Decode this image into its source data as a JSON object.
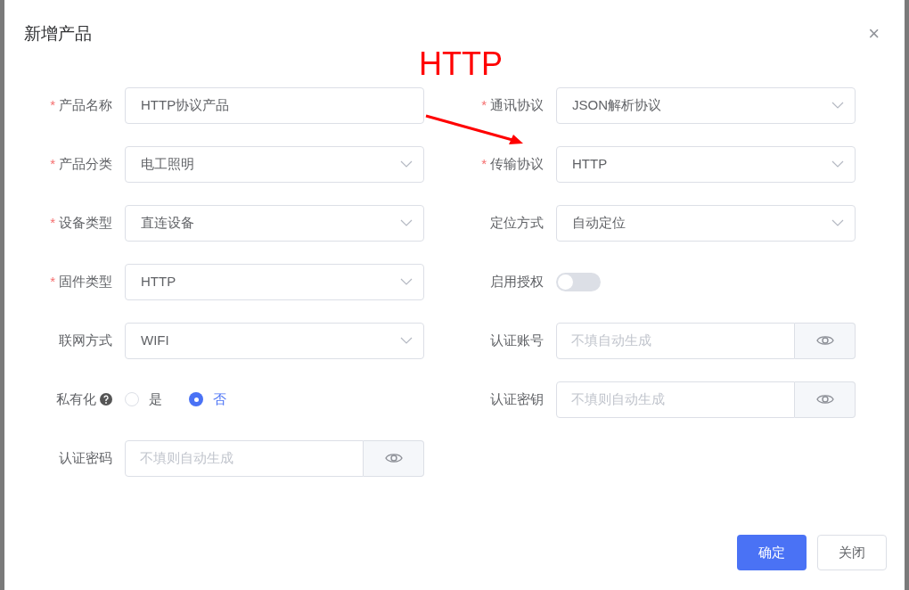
{
  "dialog": {
    "title": "新增产品",
    "close": "×"
  },
  "annotation": {
    "text": "HTTP"
  },
  "left_fields": [
    {
      "kind": "input",
      "label": "产品名称",
      "required_mark": "*",
      "value": "HTTP协议产品"
    },
    {
      "kind": "select",
      "label": "产品分类",
      "required_mark": "*",
      "value": "电工照明"
    },
    {
      "kind": "select",
      "label": "设备类型",
      "required_mark": "*",
      "value": "直连设备"
    },
    {
      "kind": "select",
      "label": "固件类型",
      "required_mark": "*",
      "value": "HTTP"
    },
    {
      "kind": "select",
      "label": "联网方式",
      "value": "WIFI"
    },
    {
      "kind": "radio",
      "label": "私有化",
      "help": true,
      "options": [
        {
          "label": "是",
          "selected": false
        },
        {
          "label": "否",
          "selected": true
        }
      ]
    },
    {
      "kind": "secret",
      "label": "认证密码",
      "placeholder": "不填则自动生成"
    }
  ],
  "right_fields": [
    {
      "kind": "select",
      "label": "通讯协议",
      "required_mark": "*",
      "value": "JSON解析协议"
    },
    {
      "kind": "select",
      "label": "传输协议",
      "required_mark": "*",
      "value": "HTTP"
    },
    {
      "kind": "select",
      "label": "定位方式",
      "value": "自动定位"
    },
    {
      "kind": "switch",
      "label": "启用授权",
      "on": false
    },
    {
      "kind": "secret",
      "label": "认证账号",
      "placeholder": "不填自动生成"
    },
    {
      "kind": "secret",
      "label": "认证密钥",
      "placeholder": "不填则自动生成"
    }
  ],
  "buttons": [
    {
      "label": "确定",
      "kind": "primary"
    },
    {
      "label": "关闭",
      "kind": "default"
    }
  ]
}
